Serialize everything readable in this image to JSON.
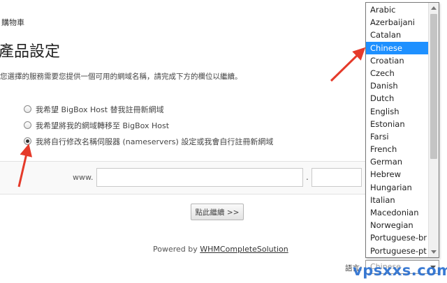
{
  "breadcrumb": {
    "cart_link": "購物車"
  },
  "page": {
    "title": "產品設定",
    "intro": "您選擇的服務需要您提供一個可用的網域名稱，請完成下方的欄位以繼續。"
  },
  "domain_options": [
    {
      "label": "我希望 BigBox Host 替我註冊新網域",
      "checked": false
    },
    {
      "label": "我希望將我的網域轉移至 BigBox Host",
      "checked": false
    },
    {
      "label": "我將自行修改名稱伺服器 (nameservers) 設定或我會自行註冊新網域",
      "checked": true
    }
  ],
  "domain_entry": {
    "prefix": "www.",
    "name_value": "",
    "separator": ".",
    "tld_value": ""
  },
  "continue_button": "點此繼續 >>",
  "footer": {
    "powered_by": "Powered by ",
    "link_text": "WHMCompleteSolution"
  },
  "language": {
    "label": "語言:",
    "current_value": "Chinese",
    "options": [
      "Arabic",
      "Azerbaijani",
      "Catalan",
      "Chinese",
      "Croatian",
      "Czech",
      "Danish",
      "Dutch",
      "English",
      "Estonian",
      "Farsi",
      "French",
      "German",
      "Hebrew",
      "Hungarian",
      "Italian",
      "Macedonian",
      "Norwegian",
      "Portuguese-br",
      "Portuguese-pt"
    ],
    "highlighted": "Chinese"
  },
  "annotation": {
    "arrow_color": "#e53a2a"
  },
  "watermark": "vpsxxs.com"
}
